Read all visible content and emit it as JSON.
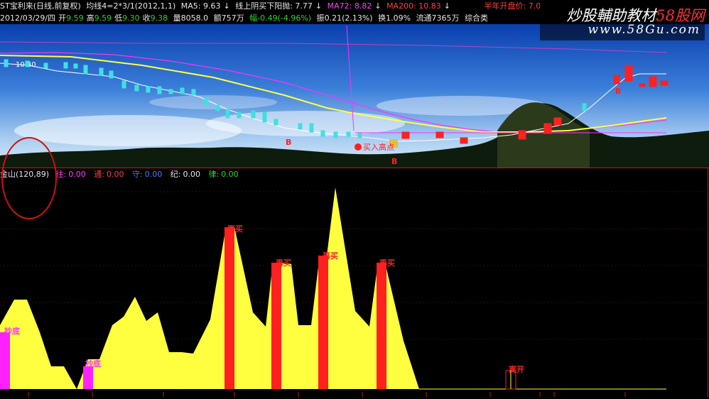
{
  "topbar": {
    "stock_title": "ST宝利来(日线,前复权)",
    "ma_config": "均线4=2*3/1(2012,1,1)",
    "ma5": "MA5: 9.63",
    "ma5_arrow": "↓",
    "line_text": "线上阴买下阳抛: 7.77",
    "line_arrow": "↓",
    "ma72": "MA72: 8.82",
    "ma72_arrow": "↓",
    "ma200": "MA200: 10.83",
    "ma200_arrow": "↓",
    "half_year": "半年开盘价: 7.0"
  },
  "infobar": {
    "date": "2012/03/29/四",
    "open_label": "开",
    "open_value": "9.59",
    "high_label": "高",
    "high_value": "9.59",
    "low_label": "低",
    "low_value": "9.30",
    "close_label": "收",
    "close_value": "9.38",
    "volume": "量8058.0",
    "amount": "额757万",
    "change": "幅-0.49(-4.96%)",
    "amplitude": "振0.21(2.13%)",
    "turnover": "换1.09%",
    "float": "流通7365万",
    "category": "综合类"
  },
  "watermark": {
    "title_a": "炒股輔助教材",
    "title_b": "58股网",
    "url": "www.58Gu.com"
  },
  "main_chart": {
    "price_label": "10.40",
    "b_markers": [
      "B",
      "B",
      "B"
    ],
    "signal_text": "买入高点"
  },
  "indicator": {
    "name": "金山(120,89)",
    "items": [
      {
        "label": "往:",
        "value": "0.00"
      },
      {
        "label": "通:",
        "value": "0.00"
      },
      {
        "label": "守:",
        "value": "0.00"
      },
      {
        "label": "纪:",
        "value": "0.00"
      },
      {
        "label": "律:",
        "value": "0.00"
      }
    ],
    "signals": [
      "抄底",
      "抄底",
      "再买",
      "再买",
      "再买",
      "再买",
      "离开"
    ]
  },
  "colors": {
    "background": "#000000",
    "up": "#ff2020",
    "down": "#40e0e0",
    "yellow_area": "#ffff40",
    "magenta": "#ff40ff"
  }
}
